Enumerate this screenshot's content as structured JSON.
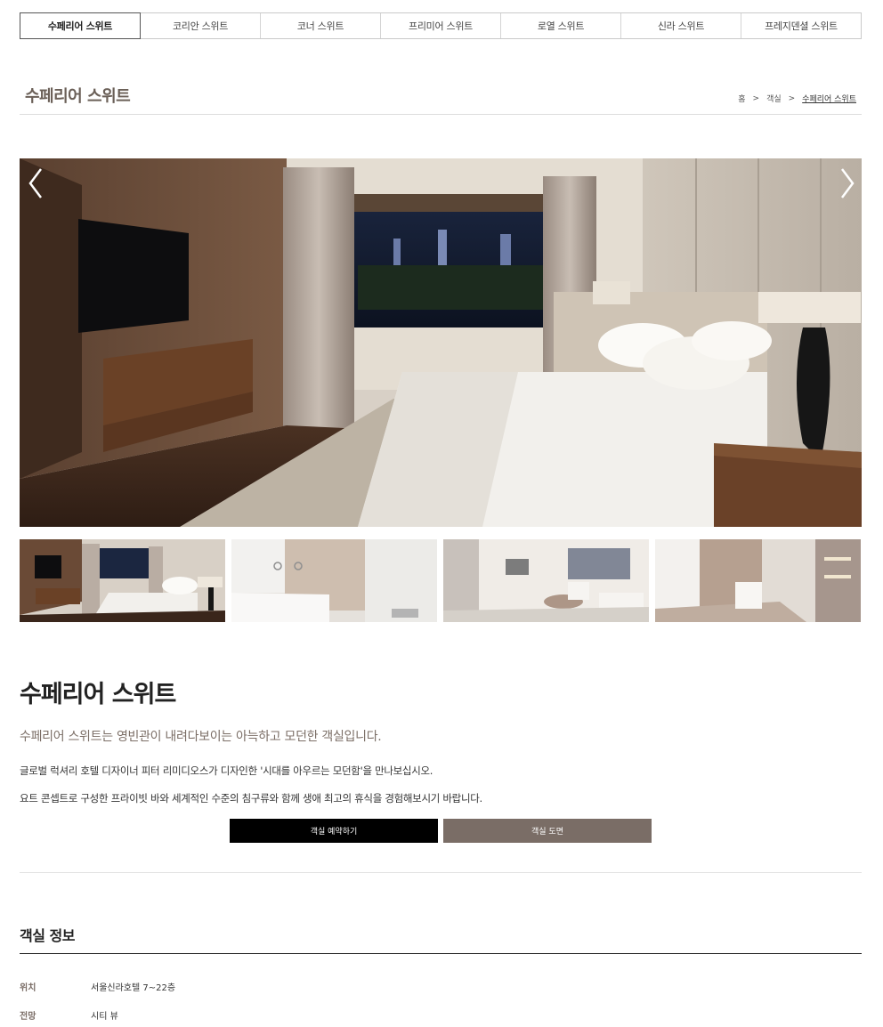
{
  "tabs": [
    {
      "label": "수페리어 스위트",
      "active": true
    },
    {
      "label": "코리안 스위트",
      "active": false
    },
    {
      "label": "코너 스위트",
      "active": false
    },
    {
      "label": "프리미어 스위트",
      "active": false
    },
    {
      "label": "로열 스위트",
      "active": false
    },
    {
      "label": "신라 스위트",
      "active": false
    },
    {
      "label": "프레지덴셜 스위트",
      "active": false
    }
  ],
  "header": {
    "title": "수페리어 스위트",
    "breadcrumb": [
      "홈",
      "객실",
      "수페리어 스위트"
    ]
  },
  "gallery": {
    "prev_icon": "chevron-left-icon",
    "next_icon": "chevron-right-icon",
    "thumbnails": [
      "bedroom",
      "bathroom",
      "living-room",
      "study"
    ]
  },
  "room": {
    "title": "수페리어 스위트",
    "subtitle": "수페리어 스위트는 영빈관이 내려다보이는 아늑하고 모던한 객실입니다.",
    "desc1": "글로벌 럭셔리 호텔 디자이너 피터 리미디오스가 디자인한 '시대를 아우르는 모던함'을 만나보십시오.",
    "desc2": "요트 콘셉트로 구성한 프라이빗 바와 세계적인 수준의 침구류와 함께 생애 최고의 휴식을 경험해보시기 바랍니다.",
    "reserve_label": "객실 예약하기",
    "floorplan_label": "객실 도면"
  },
  "info": {
    "title": "객실 정보",
    "rows": [
      {
        "key": "위치",
        "value": "서울신라호텔 7~22층"
      },
      {
        "key": "전망",
        "value": "시티 뷰"
      }
    ]
  },
  "colors": {
    "accent": "#7a6d66",
    "title_brown": "#6b6058"
  }
}
